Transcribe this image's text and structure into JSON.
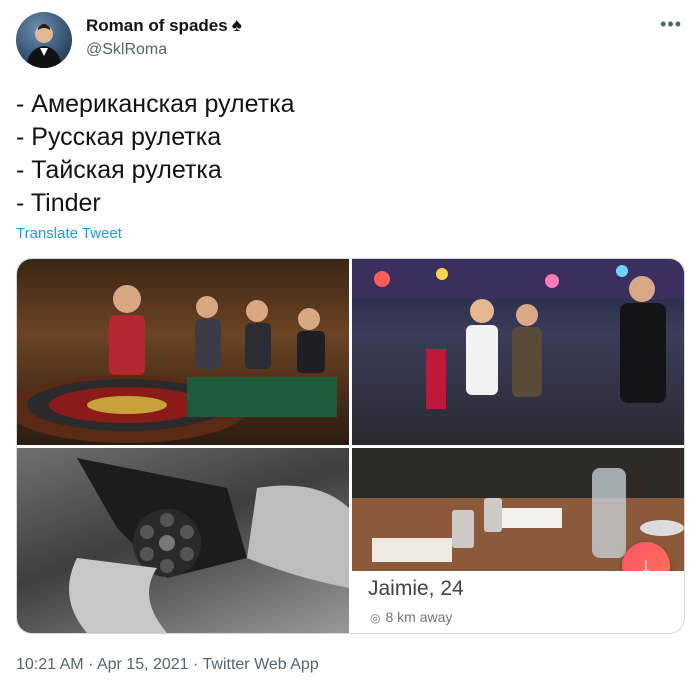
{
  "author": {
    "display_name": "Roman of spades",
    "badge_symbol": "♠",
    "handle": "@SklRoma"
  },
  "more_icon": "more-horizontal-icon",
  "tweet": {
    "lines": [
      "- Американская рулетка",
      "- Русская рулетка",
      "- Тайская рулетка",
      "- Tinder"
    ],
    "translate_label": "Translate Tweet"
  },
  "media": {
    "tinder": {
      "name": "Jaimie, 24",
      "distance": "8 km away",
      "pin_icon": "location-pin-icon",
      "action_icon": "arrow-down-icon"
    }
  },
  "timestamp": {
    "time": "10:21 AM",
    "separator": "·",
    "date": "Apr 15, 2021",
    "source": "Twitter Web App"
  },
  "colors": {
    "link": "#1d9bf0",
    "secondary_text": "#536471",
    "tinder_gradient_start": "#fd5068",
    "tinder_gradient_end": "#ff7854"
  }
}
